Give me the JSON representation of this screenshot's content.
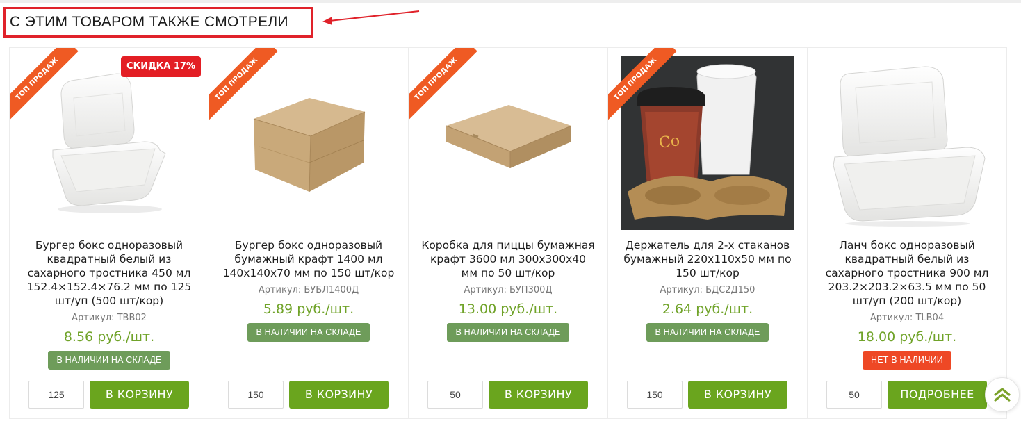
{
  "section": {
    "title": "С ЭТИМ ТОВАРОМ ТАКЖЕ СМОТРЕЛИ"
  },
  "colors": {
    "accent_green": "#6aa51e",
    "price_green": "#70a329",
    "ribbon_orange": "#ef5a23",
    "discount_red": "#e31e24",
    "in_stock": "#6e9c5a",
    "out_of_stock": "#ee4825",
    "annotation_red": "#e0222a"
  },
  "products": [
    {
      "ribbon": "ТОП ПРОДАЖ",
      "discount": "СКИДКА 17%",
      "name": "Бургер бокс одноразовый квадратный белый из сахарного тростника 450 мл 152.4×152.4×76.2 мм по 125 шт/уп (500 шт/кор)",
      "sku": "Артикул: TBB02",
      "price": "8.56 руб./шт.",
      "stock": "В НАЛИЧИИ НА СКЛАДЕ",
      "qty": "125",
      "button": "В КОРЗИНУ",
      "icon": "white-burger-box-image"
    },
    {
      "ribbon": "ТОП ПРОДАЖ",
      "name": "Бургер бокс одноразовый бумажный крафт 1400 мл 140x140x70 мм по 150 шт/кор",
      "sku": "Артикул: БУБЛ1400Д",
      "price": "5.89 руб./шт.",
      "stock": "В НАЛИЧИИ НА СКЛАДЕ",
      "qty": "150",
      "button": "В КОРЗИНУ",
      "icon": "kraft-burger-box-image"
    },
    {
      "ribbon": "ТОП ПРОДАЖ",
      "name": "Коробка для пиццы бумажная крафт 3600 мл 300x300x40 мм по 50 шт/кор",
      "sku": "Артикул: БУП300Д",
      "price": "13.00 руб./шт.",
      "stock": "В НАЛИЧИИ НА СКЛАДЕ",
      "qty": "50",
      "button": "В КОРЗИНУ",
      "icon": "pizza-box-image"
    },
    {
      "ribbon": "ТОП ПРОДАЖ",
      "name": "Держатель для 2-х стаканов бумажный 220x110x50 мм по 150 шт/кор",
      "sku": "Артикул: БДС2Д150",
      "price": "2.64 руб./шт.",
      "stock": "В НАЛИЧИИ НА СКЛАДЕ",
      "qty": "150",
      "button": "В КОРЗИНУ",
      "icon": "cup-holder-image"
    },
    {
      "name": "Ланч бокс одноразовый квадратный белый из сахарного тростника 900 мл 203.2×203.2×63.5 мм по 50 шт/уп (200 шт/кор)",
      "sku": "Артикул: TLB04",
      "price": "18.00 руб./шт.",
      "stock": "НЕТ В НАЛИЧИИ",
      "qty": "50",
      "button": "ПОДРОБНЕЕ",
      "icon": "white-lunch-box-image"
    }
  ]
}
